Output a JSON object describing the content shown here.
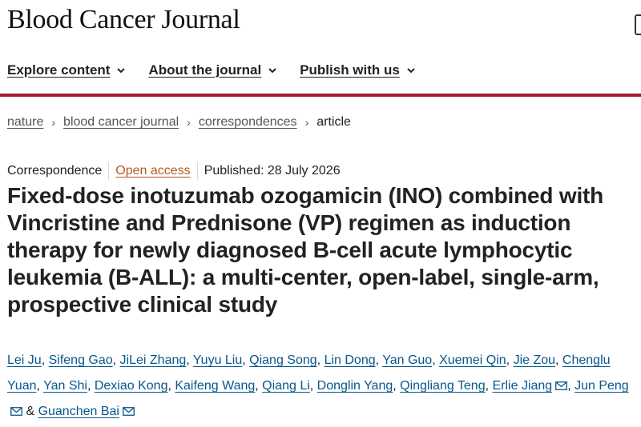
{
  "header": {
    "journal_name": "Blood Cancer Journal"
  },
  "nav": {
    "items": [
      {
        "label": "Explore content",
        "icon": "chevron-down-icon"
      },
      {
        "label": "About the journal",
        "icon": "chevron-down-icon"
      },
      {
        "label": "Publish with us",
        "icon": "chevron-down-icon"
      }
    ]
  },
  "colors": {
    "accent_rule": "#a11d2a",
    "author_link": "#06578c",
    "open_access": "#b95a20"
  },
  "breadcrumb": {
    "items": [
      "nature",
      "blood cancer journal",
      "correspondences"
    ],
    "current": "article",
    "separator": "›"
  },
  "article": {
    "type": "Correspondence",
    "access": "Open access",
    "published": "Published: 28 July 2026",
    "title": "Fixed-dose inotuzumab ozogamicin (INO) combined with Vincristine and Prednisone (VP) regimen as induction therapy for newly diagnosed B-cell acute lymphocytic leukemia (B-ALL): a multi-center, open-label, single-arm, prospective clinical study",
    "authors": [
      {
        "name": "Lei Ju"
      },
      {
        "name": "Sifeng Gao"
      },
      {
        "name": "JiLei Zhang"
      },
      {
        "name": "Yuyu Liu"
      },
      {
        "name": "Qiang Song"
      },
      {
        "name": "Lin Dong"
      },
      {
        "name": "Yan Guo"
      },
      {
        "name": "Xuemei Qin"
      },
      {
        "name": "Jie Zou"
      },
      {
        "name": "Chenglu Yuan"
      },
      {
        "name": "Yan Shi"
      },
      {
        "name": "Dexiao Kong"
      },
      {
        "name": "Kaifeng Wang"
      },
      {
        "name": "Qiang Li"
      },
      {
        "name": "Donglin Yang"
      },
      {
        "name": "Qingliang Teng"
      },
      {
        "name": "Erlie Jiang",
        "corresponding": true
      },
      {
        "name": "Jun Peng",
        "corresponding": true
      },
      {
        "name": "Guanchen Bai",
        "corresponding": true
      }
    ],
    "author_separator": ",",
    "author_final_joiner": "&",
    "mail_icon": "mail-icon"
  }
}
